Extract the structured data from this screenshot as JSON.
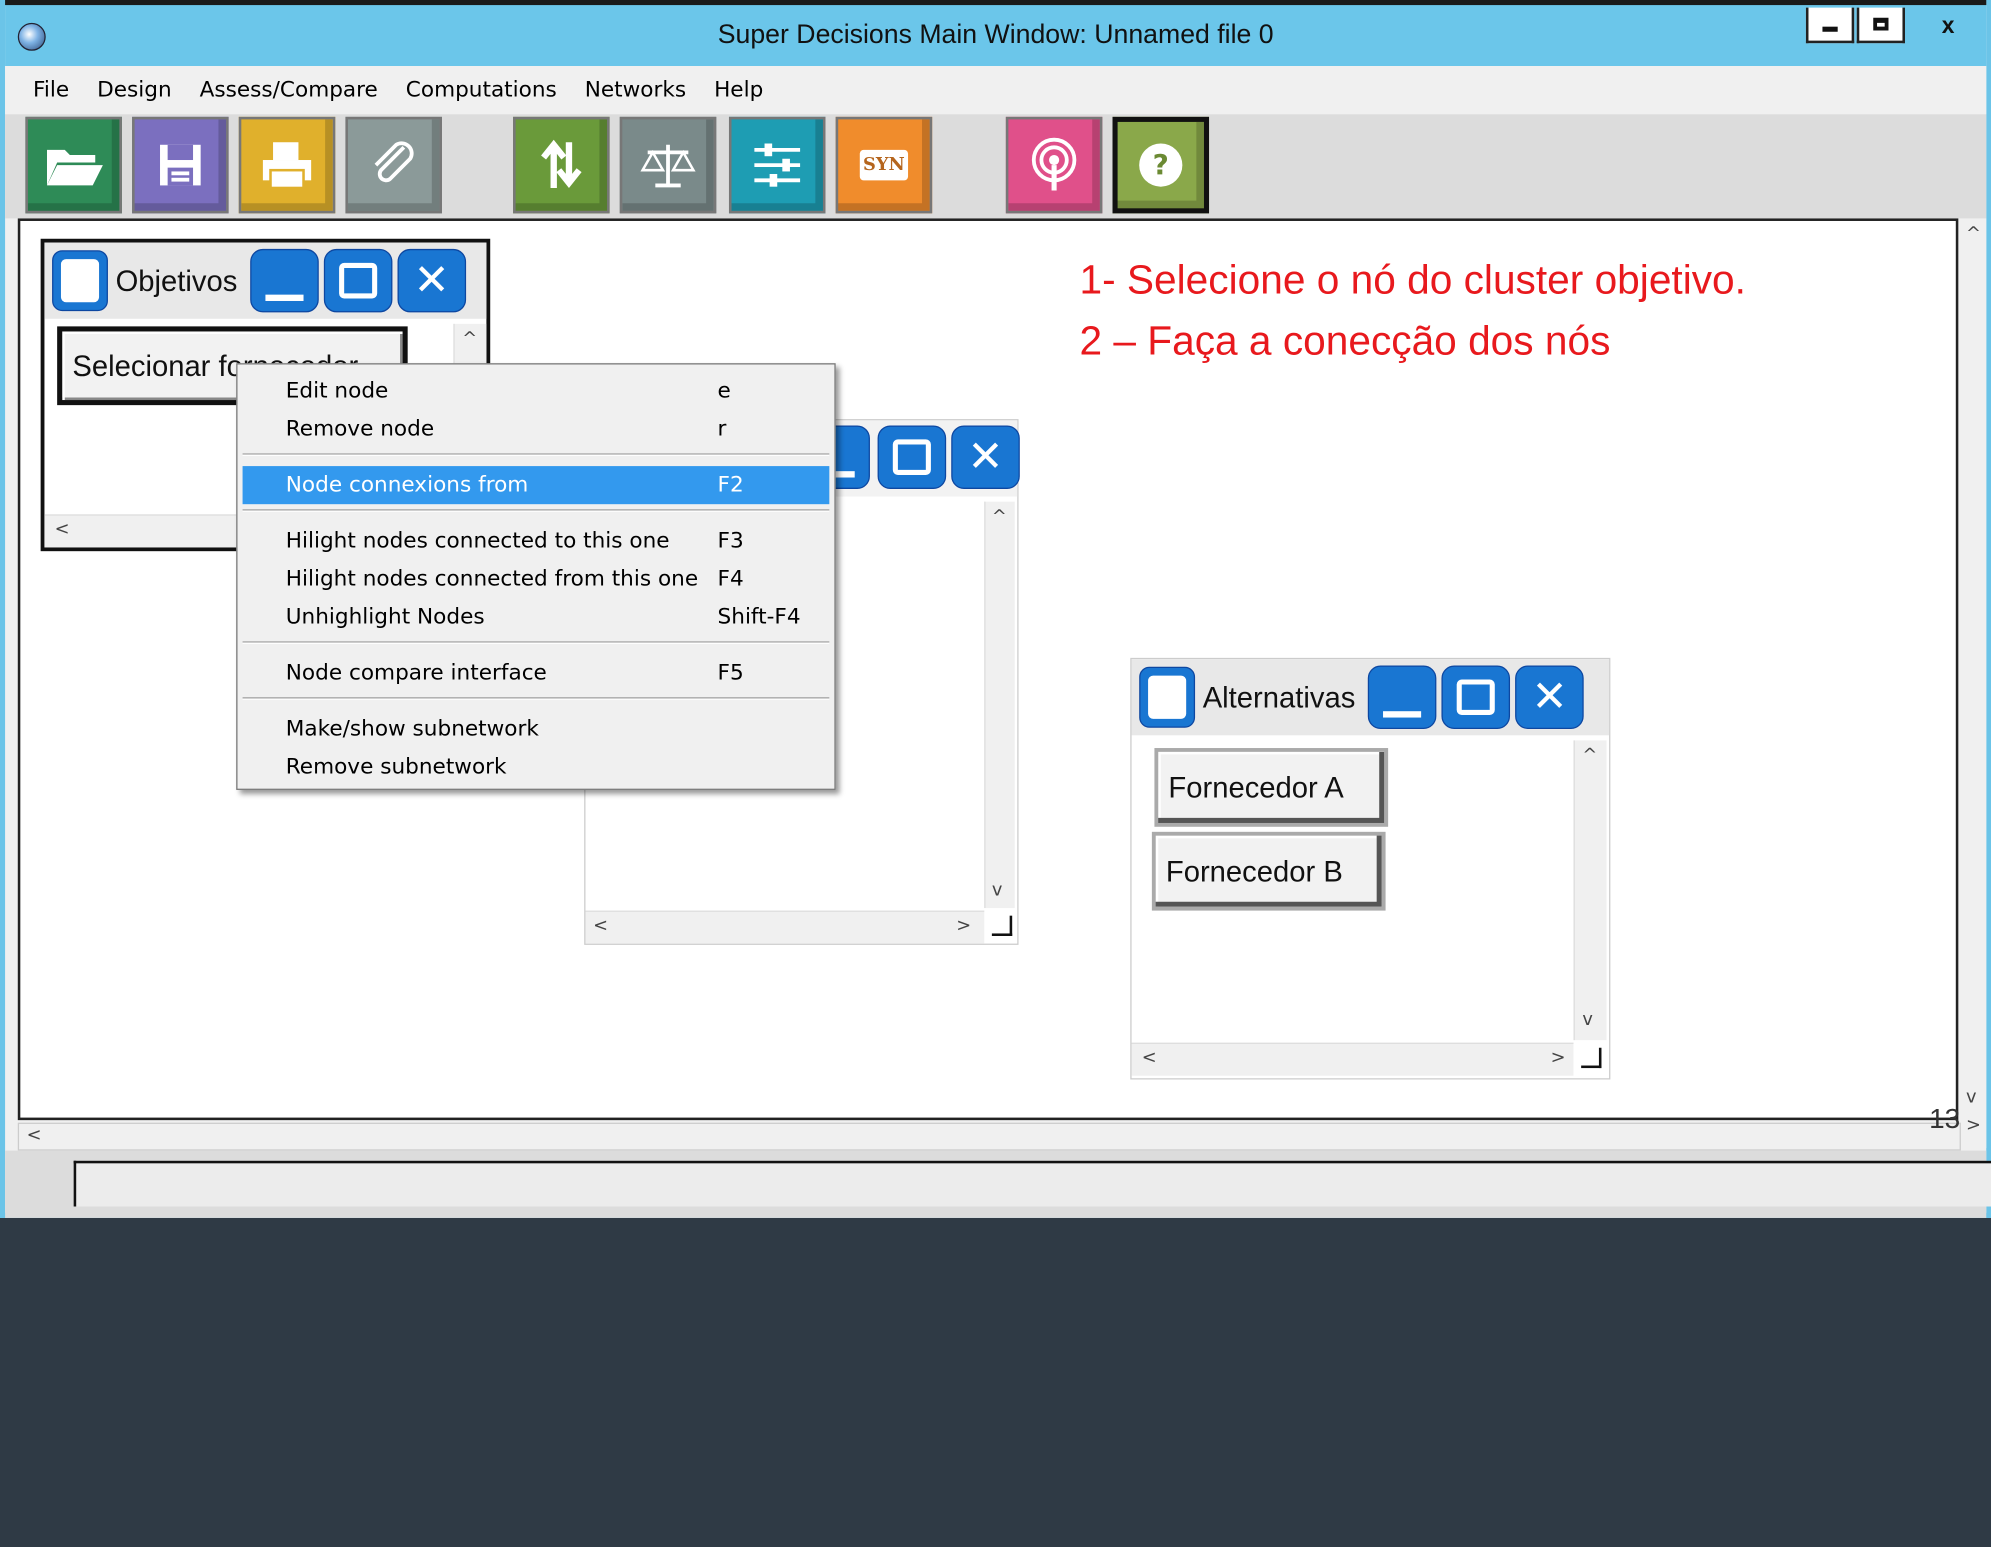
{
  "window": {
    "title": "Super Decisions Main Window: Unnamed file 0",
    "controls": {
      "minimize": "_",
      "maximize": "□",
      "close": "x"
    }
  },
  "menu": [
    "File",
    "Design",
    "Assess/Compare",
    "Computations",
    "Networks",
    "Help"
  ],
  "toolbar": [
    {
      "icon": "folder-open-icon",
      "color": "#2e8b57"
    },
    {
      "icon": "save-icon",
      "color": "#7b6fbf"
    },
    {
      "icon": "print-icon",
      "color": "#e0b02c"
    },
    {
      "icon": "paperclip-icon",
      "color": "#8b9a99"
    },
    {
      "icon": "refresh-icon",
      "color": "#6a9a3a"
    },
    {
      "icon": "balance-scale-icon",
      "color": "#7a8a8a"
    },
    {
      "icon": "sliders-icon",
      "color": "#1e9db3"
    },
    {
      "icon": "syn-icon",
      "label": "SYN",
      "color": "#f08c2c"
    },
    {
      "icon": "broadcast-icon",
      "color": "#e0508a"
    },
    {
      "icon": "help-icon",
      "label": "?",
      "color": "#8aa84a"
    }
  ],
  "clusters": {
    "objetivos": {
      "name": "Objetivos",
      "nodes": [
        "Selecionar fornecedor"
      ]
    },
    "criterios": {
      "name": ""
    },
    "alternativas": {
      "name": "Alternativas",
      "nodes": [
        "Fornecedor A",
        "Fornecedor B"
      ]
    }
  },
  "context_menu": {
    "items": [
      {
        "label": "Edit node",
        "key": "e"
      },
      {
        "label": "Remove node",
        "key": "r"
      },
      {
        "label": "Node connexions from",
        "key": "F2",
        "selected": true
      },
      {
        "label": "Hilight nodes connected to this one",
        "key": "F3"
      },
      {
        "label": "Hilight nodes connected from this one",
        "key": "F4"
      },
      {
        "label": "Unhighlight Nodes",
        "key": "Shift-F4"
      },
      {
        "label": "Node compare interface",
        "key": "F5"
      },
      {
        "label": "Make/show subnetwork",
        "key": ""
      },
      {
        "label": "Remove subnetwork",
        "key": ""
      }
    ]
  },
  "annotations": {
    "line1": "1- Selecione o nó do cluster objetivo.",
    "line2": "2 – Faça a conecção dos nós",
    "color": "#e8191d"
  },
  "page_number": "13",
  "scroll_arrows": {
    "up": "^",
    "down": "v",
    "left": "<",
    "right": ">"
  }
}
